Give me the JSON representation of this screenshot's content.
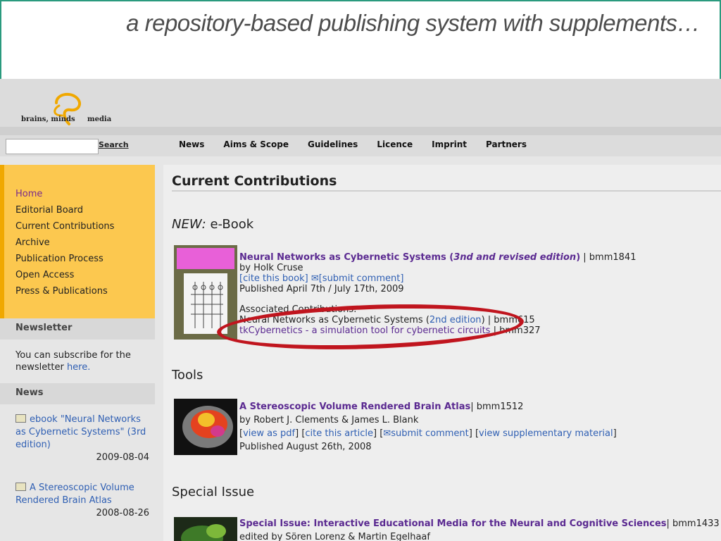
{
  "slide": {
    "title": "a repository-based publishing system with supplements…"
  },
  "logo": {
    "left": "brains, minds",
    "right": "media"
  },
  "search": {
    "placeholder": "",
    "button": "Search"
  },
  "nav": [
    "News",
    "Aims & Scope",
    "Guidelines",
    "Licence",
    "Imprint",
    "Partners"
  ],
  "sidebar": {
    "items": [
      "Home",
      "Editorial Board",
      "Current Contributions",
      "Archive",
      "Publication Process",
      "Open Access",
      "Press & Publications"
    ],
    "newsletter_head": "Newsletter",
    "newsletter_text": "You can subscribe for the newsletter",
    "newsletter_link": "here.",
    "news_head": "News",
    "news": [
      {
        "title": "ebook \"Neural Networks as Cybernetic Systems\" (3rd edition)",
        "date": "2009-08-04"
      },
      {
        "title": "A Stereoscopic Volume Rendered Brain Atlas",
        "date": "2008-08-26"
      }
    ]
  },
  "main": {
    "title": "Current Contributions",
    "sec1_em": "NEW:",
    "sec1_rest": "e-Book",
    "sec2": "Tools",
    "sec3": "Special Issue",
    "book": {
      "title": "Neural Networks as Cybernetic Systems (",
      "title_em": "3nd and revised edition",
      "title_end": ")",
      "id": "| bmm1841",
      "by": "by Holk Cruse",
      "cite": "[cite this book]",
      "comment": "[submit comment]",
      "published": "Published April 7th / July 17th, 2009",
      "assoc_head": "Associated Contributions:",
      "assoc1": "Neural Networks as Cybernetic Systems (",
      "assoc1_link": "2nd edition",
      "assoc1_end": ") | bmm615",
      "assoc2_link": "tkCybernetics - a simulation tool for cybernetic circuits",
      "assoc2_end": " | bmm327"
    },
    "tool": {
      "title": "A Stereoscopic Volume Rendered Brain Atlas",
      "id": "| bmm1512",
      "by": "by Robert J. Clements & James L. Blank",
      "l1": "view as pdf",
      "l2": "cite this article",
      "l3": "submit comment",
      "l4": "view supplementary material",
      "published": "Published August 26th, 2008"
    },
    "special": {
      "title": "Special Issue: Interactive Educational Media for the Neural and Cognitive Sciences",
      "id": "| bmm1433",
      "by": "edited by Sören Lorenz & Martin Egelhaaf"
    }
  }
}
